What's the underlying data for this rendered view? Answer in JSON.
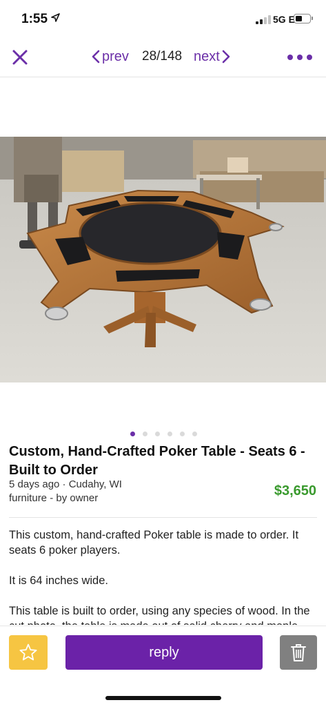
{
  "status_bar": {
    "time": "1:55",
    "network": "5G E",
    "battery_level": 0.35
  },
  "nav": {
    "prev_label": "prev",
    "counter": "28/148",
    "next_label": "next"
  },
  "photo": {
    "carousel_count": 6,
    "active_index": 0
  },
  "listing": {
    "title": "Custom, Hand-Crafted Poker Table - Seats 6 - Built to Order",
    "posted": "5 days ago · Cudahy, WI",
    "category": "furniture - by owner",
    "price": "$3,650",
    "description": [
      "This custom, hand-crafted Poker table is made to order. It seats 6 poker players.",
      "It is 64 inches wide.",
      "This table is built to order, using any species of wood. In the cut photo, the table is made out of solid cherry and maple."
    ]
  },
  "actions": {
    "reply_label": "reply"
  },
  "colors": {
    "accent": "#6b22a8",
    "price": "#3a9a2e",
    "favorite": "#f6c542",
    "delete": "#808080"
  }
}
